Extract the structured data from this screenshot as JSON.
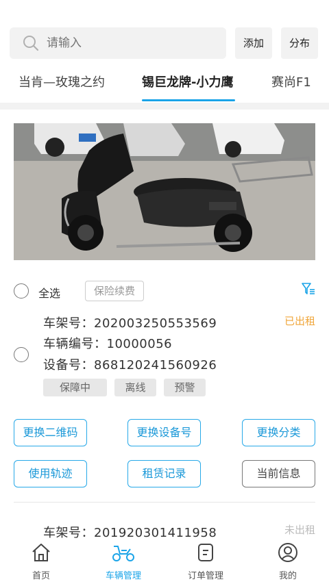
{
  "search": {
    "placeholder": "请输入",
    "add_label": "添加",
    "distribute_label": "分布"
  },
  "tabs": [
    {
      "label": "当肯—玫瑰之约"
    },
    {
      "label": "锡巨龙牌-小力鹰"
    },
    {
      "label": "赛尚F1"
    }
  ],
  "active_tab_index": 1,
  "toolbar": {
    "select_all_label": "全选",
    "insurance_label": "保险续费"
  },
  "vehicles": [
    {
      "frame_no": "车架号：202003250553569",
      "vehicle_no": "车辆编号：10000056",
      "device_no": "设备号：868120241560926",
      "status": "已出租",
      "status_color": "#f0a63a",
      "tags": [
        "保障中",
        "离线",
        "预警"
      ],
      "actions": [
        "更换二维码",
        "更换设备号",
        "更换分类",
        "使用轨迹",
        "租赁记录",
        "当前信息"
      ]
    },
    {
      "frame_no": "车架号：201920301411958",
      "status": "未出租",
      "status_color": "#bbbbbb"
    }
  ],
  "bottom_nav": [
    {
      "label": "首页",
      "icon": "home-icon"
    },
    {
      "label": "车辆管理",
      "icon": "scooter-icon"
    },
    {
      "label": "订单管理",
      "icon": "order-icon"
    },
    {
      "label": "我的",
      "icon": "profile-icon"
    }
  ],
  "colors": {
    "accent": "#1aa4e8",
    "rented": "#f0a63a",
    "not_rented": "#bbbbbb"
  }
}
